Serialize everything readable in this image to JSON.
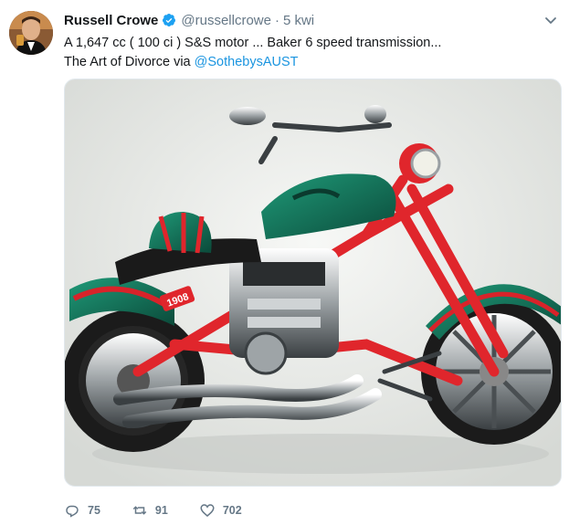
{
  "tweet": {
    "author_name": "Russell Crowe",
    "handle": "@russellcrowe",
    "separator": "·",
    "time": "5 kwi",
    "text_line1": "A 1,647 cc ( 100 ci ) S&S motor ... Baker 6 speed transmission...",
    "text_line2_prefix": "The Art of Divorce via ",
    "mention": "@SothebysAUST",
    "plate_number": "1908",
    "icons": {
      "verified": "verified-badge-icon",
      "caret": "chevron-down-icon",
      "reply": "reply-icon",
      "retweet": "retweet-icon",
      "like": "heart-icon"
    },
    "colors": {
      "mention": "#1b95e0",
      "verified": "#1da1f2",
      "secondary_text": "#657786"
    }
  },
  "actions": {
    "reply_count": "75",
    "retweet_count": "91",
    "like_count": "702"
  }
}
